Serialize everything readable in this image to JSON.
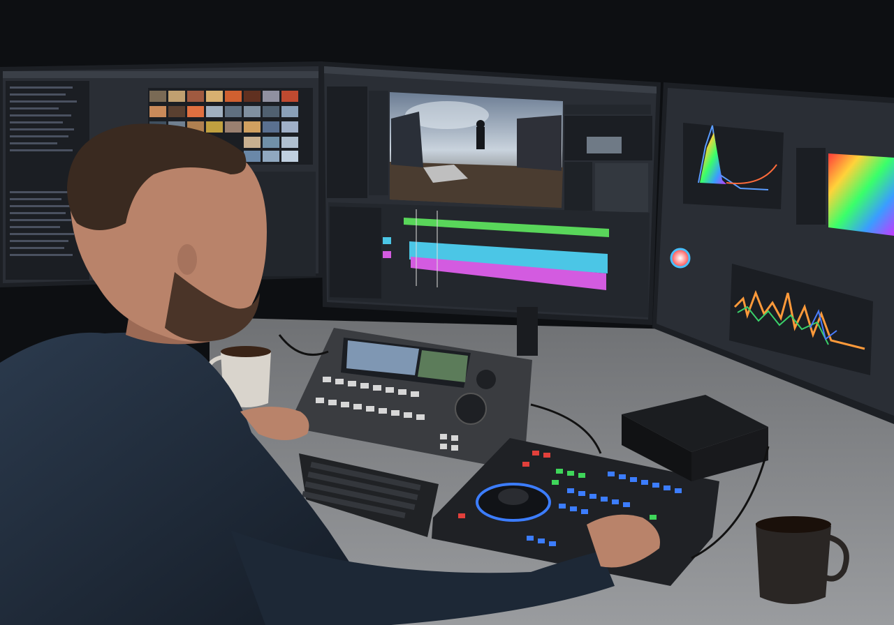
{
  "scene": {
    "description_none": "",
    "monitors": [
      {
        "id": "left",
        "content": "media-browser"
      },
      {
        "id": "center",
        "content": "timeline-editor"
      },
      {
        "id": "right",
        "content": "color-grading-scopes"
      }
    ],
    "devices": {
      "device_label_top": "",
      "device_label_bottom": ""
    }
  },
  "colors": {
    "background": "#0d0f12",
    "desk": "#8f9194",
    "monitor_bezel": "#1c1f24",
    "ui_panel": "#2a2e35",
    "ui_dark": "#1b1e23",
    "track_green": "#59d65a",
    "track_cyan": "#4bc6e6",
    "track_magenta": "#d35be0",
    "shirt": "#1f2b3a",
    "skin": "#b9836a",
    "hair": "#3a2a20",
    "mug": "#d9d4cc",
    "keypad_red": "#e2403b",
    "keypad_green": "#3fd65a",
    "keypad_blue": "#3c7dff"
  },
  "icons": [
    "color-wheel-icon",
    "histogram-scope-icon",
    "waveform-scope-icon",
    "jog-wheel-icon"
  ]
}
